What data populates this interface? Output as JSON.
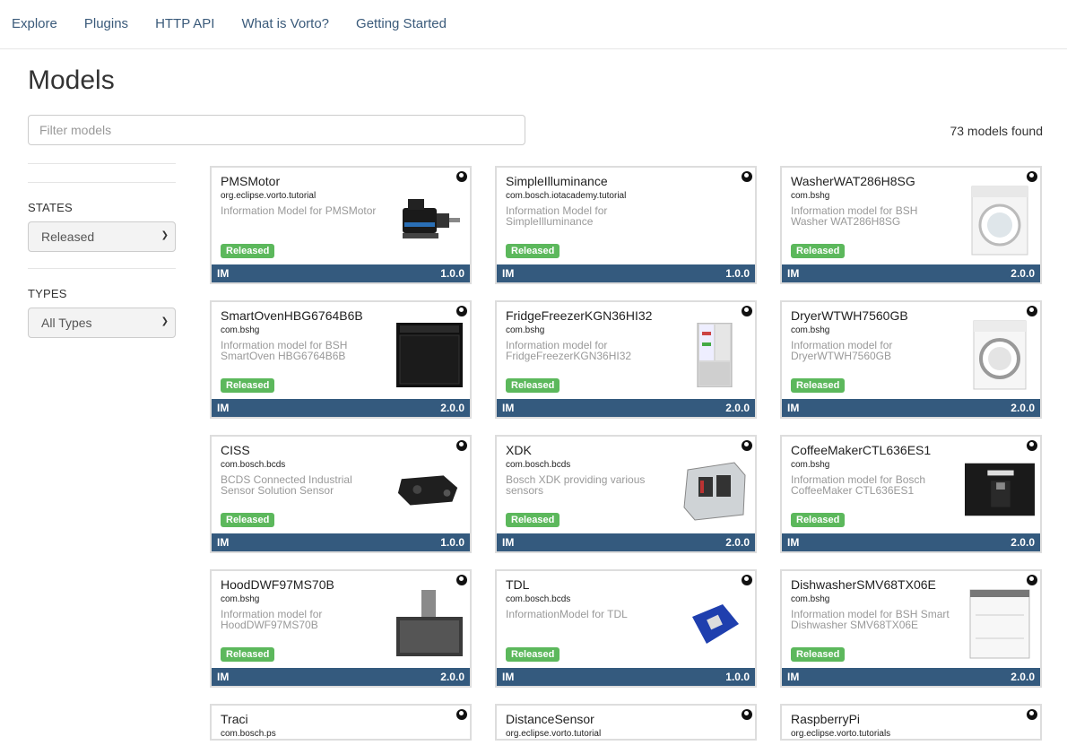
{
  "nav": [
    "Explore",
    "Plugins",
    "HTTP API",
    "What is Vorto?",
    "Getting Started"
  ],
  "page_title": "Models",
  "filter": {
    "placeholder": "Filter models"
  },
  "count_text": "73 models found",
  "sidebar": {
    "states_label": "STATES",
    "states_value": "Released",
    "types_label": "TYPES",
    "types_value": "All Types"
  },
  "cards": [
    {
      "name": "PMSMotor",
      "namespace": "org.eclipse.vorto.tutorial",
      "description": "Information Model for PMSMotor",
      "status": "Released",
      "type": "IM",
      "version": "1.0.0",
      "icon": "motor"
    },
    {
      "name": "SimpleIlluminance",
      "namespace": "com.bosch.iotacademy.tutorial",
      "description": "Information Model for SimpleIlluminance",
      "status": "Released",
      "type": "IM",
      "version": "1.0.0",
      "icon": ""
    },
    {
      "name": "WasherWAT286H8SG",
      "namespace": "com.bshg",
      "description": "Information model for BSH Washer WAT286H8SG",
      "status": "Released",
      "type": "IM",
      "version": "2.0.0",
      "icon": "washer"
    },
    {
      "name": "SmartOvenHBG6764B6B",
      "namespace": "com.bshg",
      "description": "Information model for BSH SmartOven HBG6764B6B",
      "status": "Released",
      "type": "IM",
      "version": "2.0.0",
      "icon": "oven"
    },
    {
      "name": "FridgeFreezerKGN36HI32",
      "namespace": "com.bshg",
      "description": "Information model for FridgeFreezerKGN36HI32",
      "status": "Released",
      "type": "IM",
      "version": "2.0.0",
      "icon": "fridge"
    },
    {
      "name": "DryerWTWH7560GB",
      "namespace": "com.bshg",
      "description": "Information model for DryerWTWH7560GB",
      "status": "Released",
      "type": "IM",
      "version": "2.0.0",
      "icon": "dryer"
    },
    {
      "name": "CISS",
      "namespace": "com.bosch.bcds",
      "description": "BCDS Connected Industrial Sensor Solution Sensor",
      "status": "Released",
      "type": "IM",
      "version": "1.0.0",
      "icon": "ciss"
    },
    {
      "name": "XDK",
      "namespace": "com.bosch.bcds",
      "description": "Bosch XDK providing various sensors",
      "status": "Released",
      "type": "IM",
      "version": "2.0.0",
      "icon": "xdk"
    },
    {
      "name": "CoffeeMakerCTL636ES1",
      "namespace": "com.bshg",
      "description": "Information model for Bosch CoffeeMaker CTL636ES1",
      "status": "Released",
      "type": "IM",
      "version": "2.0.0",
      "icon": "coffee"
    },
    {
      "name": "HoodDWF97MS70B",
      "namespace": "com.bshg",
      "description": "Information model for HoodDWF97MS70B",
      "status": "Released",
      "type": "IM",
      "version": "2.0.0",
      "icon": "hood"
    },
    {
      "name": "TDL",
      "namespace": "com.bosch.bcds",
      "description": "InformationModel for TDL",
      "status": "Released",
      "type": "IM",
      "version": "1.0.0",
      "icon": "tdl"
    },
    {
      "name": "DishwasherSMV68TX06E",
      "namespace": "com.bshg",
      "description": "Information model for BSH Smart Dishwasher SMV68TX06E",
      "status": "Released",
      "type": "IM",
      "version": "2.0.0",
      "icon": "dishwasher"
    },
    {
      "name": "Traci",
      "namespace": "com.bosch.ps",
      "partial": true
    },
    {
      "name": "DistanceSensor",
      "namespace": "org.eclipse.vorto.tutorial",
      "partial": true
    },
    {
      "name": "RaspberryPi",
      "namespace": "org.eclipse.vorto.tutorials",
      "partial": true
    }
  ]
}
